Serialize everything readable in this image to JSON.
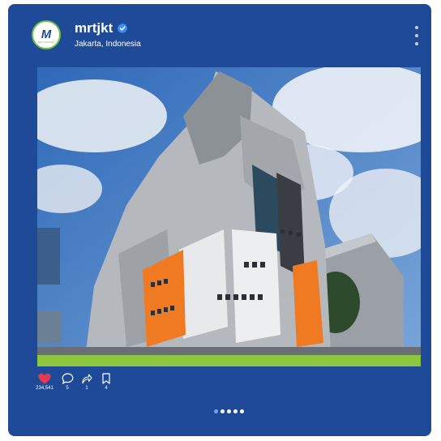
{
  "post": {
    "username": "mrtjkt",
    "verified": true,
    "location": "Jakarta, Indonesia",
    "avatar_logo": "M",
    "avatar_caption": "MRT JAKARTA",
    "image_alt": "MRT Jakarta office building"
  },
  "actions": {
    "like_count": "234,541",
    "comment_count": "5",
    "share_count": "1",
    "save_count": "4"
  },
  "carousel": {
    "total": 5,
    "active_index": 0
  },
  "colors": {
    "card_bg": "#1f4a98",
    "like": "#e53950",
    "brand_green": "#8dc63f",
    "verified": "#3d8ef7"
  }
}
